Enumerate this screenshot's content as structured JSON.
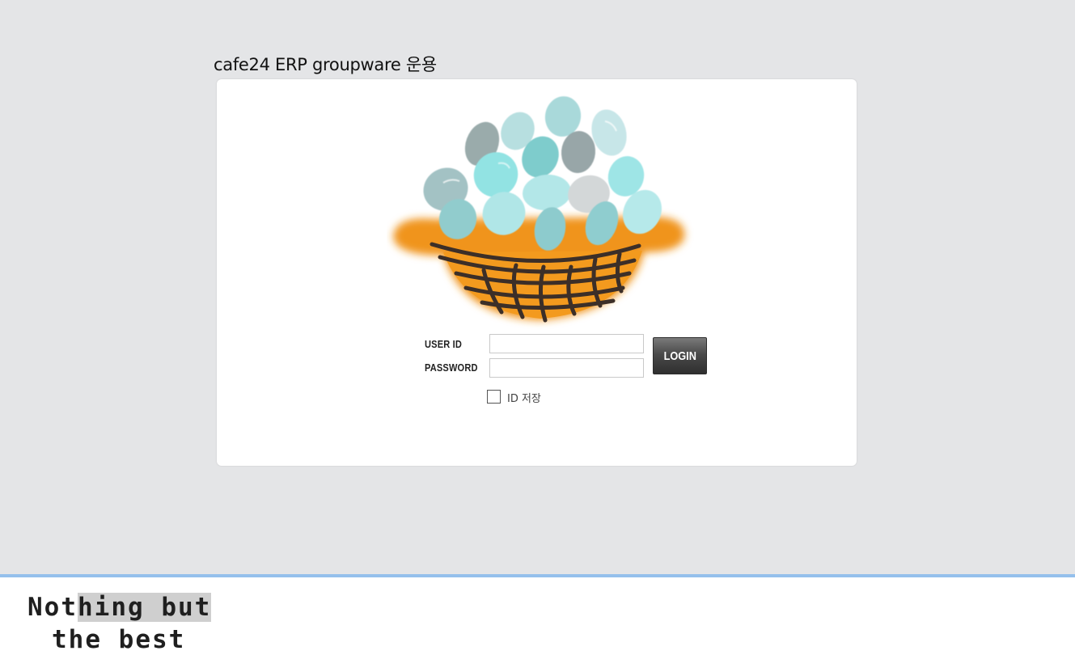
{
  "app_title": "cafe24 ERP groupware 운용",
  "login_form": {
    "user_id_label": "USER ID",
    "user_id_value": "",
    "password_label": "PASSWORD",
    "password_value": "",
    "login_button_label": "LOGIN",
    "save_id_label": "ID 저장",
    "save_id_checked": false
  },
  "footer": {
    "slogan_line_1_plain": "Not",
    "slogan_line_1_highlight": "hing but",
    "slogan_line_2": "the best"
  },
  "colors": {
    "page_background": "#e4e5e7",
    "card_background": "#ffffff",
    "footer_divider": "#94c0ec",
    "basket": "#f0941f",
    "button": "#4a4a4a"
  },
  "icons": {
    "logo": "egg-basket-logo",
    "checkbox": "checkbox-unchecked"
  }
}
